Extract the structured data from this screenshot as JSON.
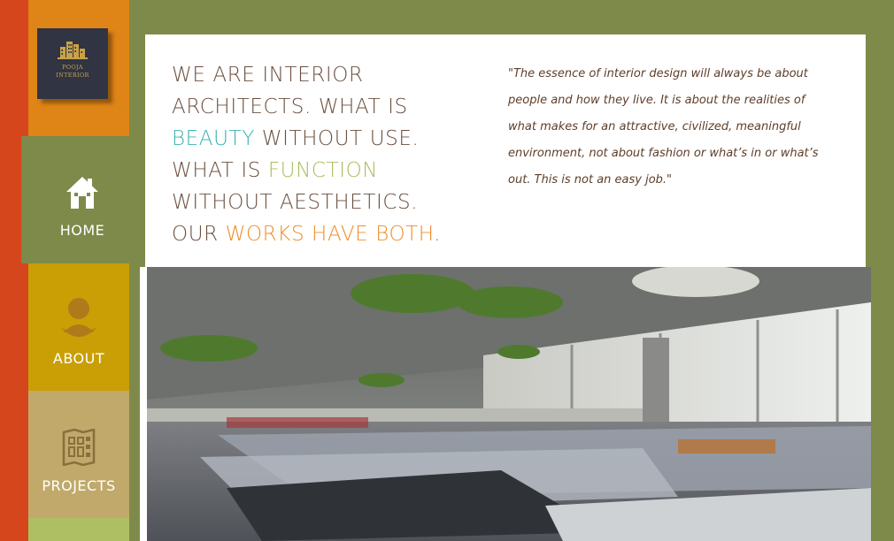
{
  "logo": {
    "line1": "POOJA",
    "line2": "INTERIOR",
    "icon": "building-icon"
  },
  "nav": [
    {
      "label": "HOME",
      "icon": "house-icon"
    },
    {
      "label": "ABOUT",
      "icon": "person-icon"
    },
    {
      "label": "PROJECTS",
      "icon": "blueprint-icon"
    }
  ],
  "headline": {
    "line1": "WE ARE INTERIOR",
    "line2": "ARCHITECTS. WHAT IS",
    "line3_accent": "BEAUTY",
    "line3_rest": " WITHOUT USE.",
    "line4_start": "WHAT IS ",
    "line4_accent": "FUNCTION",
    "line5": "WITHOUT AESTHETICS.",
    "line6_start": "OUR ",
    "line6_accent": "WORKS HAVE BOTH",
    "line6_end": "."
  },
  "quote": "\"The essence of interior design will always be about people and how they live. It is about the realities of what makes for an attractive, civilized, meaningful environment, not about fashion or what’s in or what’s out. This is not an easy job.\"",
  "colors": {
    "sidebar_green": "#7d8a4a",
    "orange": "#df8416",
    "red_strip": "#d6461d",
    "mustard": "#c99f05",
    "khaki": "#c0a96a",
    "teal_accent": "#3bb3b0",
    "green_accent": "#a8bd5f",
    "orange_accent": "#ef8d2b",
    "headline_brown": "#6b4f3e"
  }
}
